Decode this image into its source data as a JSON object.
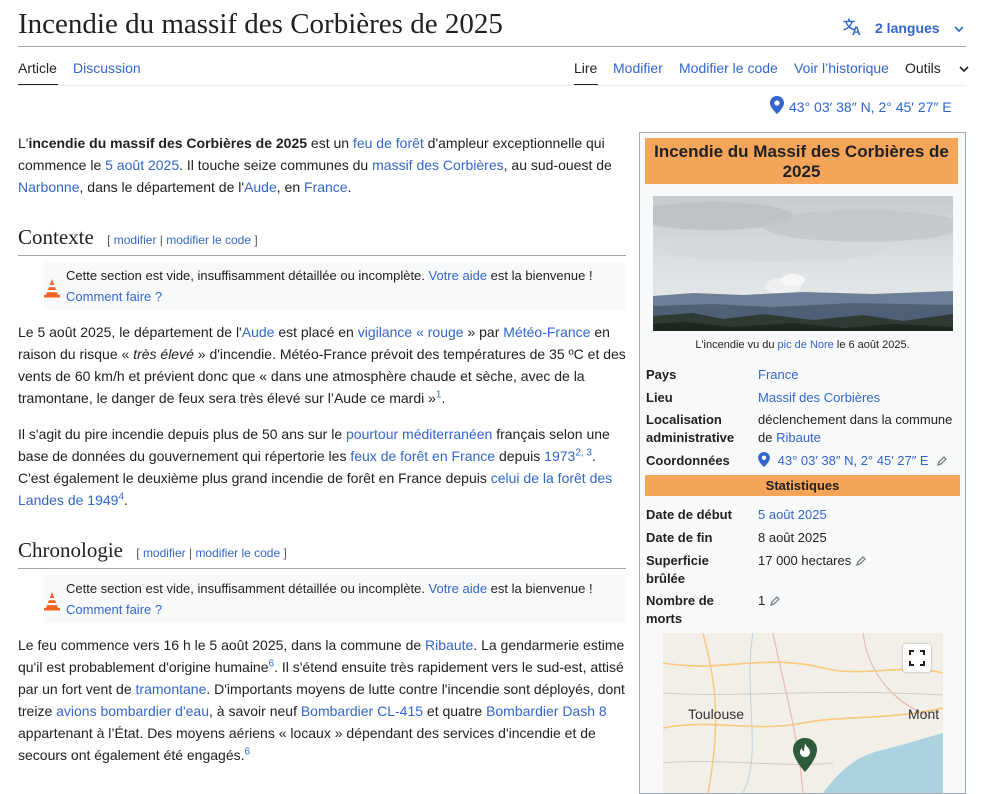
{
  "header": {
    "title": "Incendie du massif des Corbières de 2025",
    "languages_label": "2 langues"
  },
  "tabs": {
    "left": [
      "Article",
      "Discussion"
    ],
    "right": [
      "Lire",
      "Modifier",
      "Modifier le code",
      "Voir l’historique",
      "Outils"
    ]
  },
  "coordinates": "43° 03′ 38″ N, 2° 45′ 27″ E",
  "intro": {
    "p1": "L'",
    "bold": "incendie du massif des Corbières de 2025",
    "p2": " est un ",
    "l1": "feu de forêt",
    "p3": " d'ampleur exceptionnelle qui commence le ",
    "l2": "5 août 2025",
    "p4": ". Il touche seize communes du ",
    "l3": "massif des Corbières",
    "p5": ", au sud-ouest de ",
    "l4": "Narbonne",
    "p6": ", dans le département de l'",
    "l5": "Aude",
    "p7": ", en ",
    "l6": "France",
    "p8": "."
  },
  "section_edit": {
    "open": "[",
    "modifier": "modifier",
    "sep": "|",
    "modifier_code": "modifier le code",
    "close": "]"
  },
  "sections": {
    "contexte": "Contexte",
    "chronologie": "Chronologie"
  },
  "notice": {
    "text": "Cette section est vide, insuffisamment détaillée ou incomplète. ",
    "link": "Votre aide",
    "text2": " est la bienvenue !",
    "how": "Comment faire ?"
  },
  "contexte_p1": {
    "a": "Le 5 août 2025, le département de l'",
    "l1": "Aude",
    "b": " est placé en ",
    "l2": "vigilance « rouge",
    "c": " » par ",
    "l3": "Météo-France",
    "d": " en raison du risque « ",
    "em": "très élevé",
    "e": " » d'incendie. Météo-France prévoit des températures de 35 ºC et des vents de 60 km/h et prévient donc que « dans une atmosphère chaude et sèche, avec de la tramontane, le danger de feux sera très élevé sur l’Aude ce mardi »",
    "ref": "1",
    "f": "."
  },
  "contexte_p2": {
    "a": "Il s'agit du pire incendie depuis plus de 50 ans sur le ",
    "l1": "pourtour méditerranéen",
    "b": " français selon une base de données du gouvernement qui répertorie les ",
    "l2": "feux de forêt en France",
    "c": " depuis ",
    "l3": "1973",
    "ref": "2, 3",
    "d": ". C'est également le deuxième plus grand incendie de forêt en France depuis ",
    "l4": "celui de la forêt des Landes de 1949",
    "ref2": "4",
    "e": "."
  },
  "chrono_p1": {
    "a": "Le feu commence vers 16 h le 5 août 2025, dans la commune de ",
    "l1": "Ribaute",
    "b": ". La gendarmerie estime qu'il est probablement d'origine humaine",
    "ref": "6",
    "c": ". Il s'étend ensuite très rapidement vers le sud-est, attisé par un fort vent de ",
    "l2": "tramontane",
    "d": ". D'importants moyens de lutte contre l'incendie sont déployés, dont treize ",
    "l3": "avions bombardier d'eau",
    "e": ", à savoir neuf ",
    "l4": "Bombardier CL-415",
    "f": " et quatre ",
    "l5": "Bombardier Dash 8",
    "g": " appartenant à l’État. Des moyens aériens « locaux » dépendant des services d'incendie et de secours ont également été engagés."
  },
  "infobox": {
    "title": "Incendie du Massif des Corbières de 2025",
    "caption_a": "L'incendie vu du ",
    "caption_link": "pic de Nore",
    "caption_b": " le 6 août 2025.",
    "pays_label": "Pays",
    "pays_value": "France",
    "lieu_label": "Lieu",
    "lieu_value": "Massif des Corbières",
    "loc_label_1": "Localisation",
    "loc_label_2": "administrative",
    "loc_value_1": "déclenchement dans la commune",
    "loc_value_de": "de ",
    "loc_value_link": "Ribaute",
    "coord_label": "Coordonnées",
    "coord_value": "43° 03′ 38″ N, 2° 45′ 27″ E",
    "stats_header": "Statistiques",
    "debut_label": "Date de début",
    "debut_value": "5 août 2025",
    "fin_label": "Date de fin",
    "fin_value": "8 août 2025",
    "superficie_label_1": "Superficie",
    "superficie_label_2": "brûlée",
    "superficie_value": "17 000 hectares",
    "morts_label_1": "Nombre de",
    "morts_label_2": "morts",
    "morts_value": "1",
    "map_city_1": "Toulouse",
    "map_city_2": "Mont"
  },
  "colors": {
    "link": "#3366cc",
    "infobox_header": "#f5a55a",
    "rule": "#a2a9b1"
  }
}
